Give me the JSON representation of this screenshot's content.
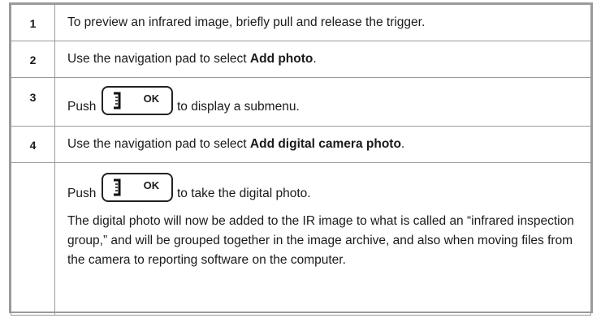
{
  "steps": [
    {
      "number": "1",
      "text": "To preview an infrared image, briefly pull and release the trigger."
    },
    {
      "number": "2",
      "text_before": "Use the navigation pad to select ",
      "text_bold": "Add photo",
      "text_after": "."
    },
    {
      "number": "3",
      "text_before": "Push",
      "key_label": "OK",
      "text_after": "to display a submenu."
    },
    {
      "number": "4",
      "text_before": "Use the navigation pad to select ",
      "text_bold": "Add digital camera photo",
      "text_after": "."
    },
    {
      "number": "",
      "text_before": "Push",
      "key_label": "OK",
      "text_after": "to take the digital photo.",
      "paragraph": "The digital photo will now be added to the IR image to what is called an “infrared inspection group,” and will be grouped together in the image archive, and also when moving files from the camera to reporting software on the computer."
    }
  ],
  "icons": {
    "key_icon": "save-bracket-icon"
  }
}
